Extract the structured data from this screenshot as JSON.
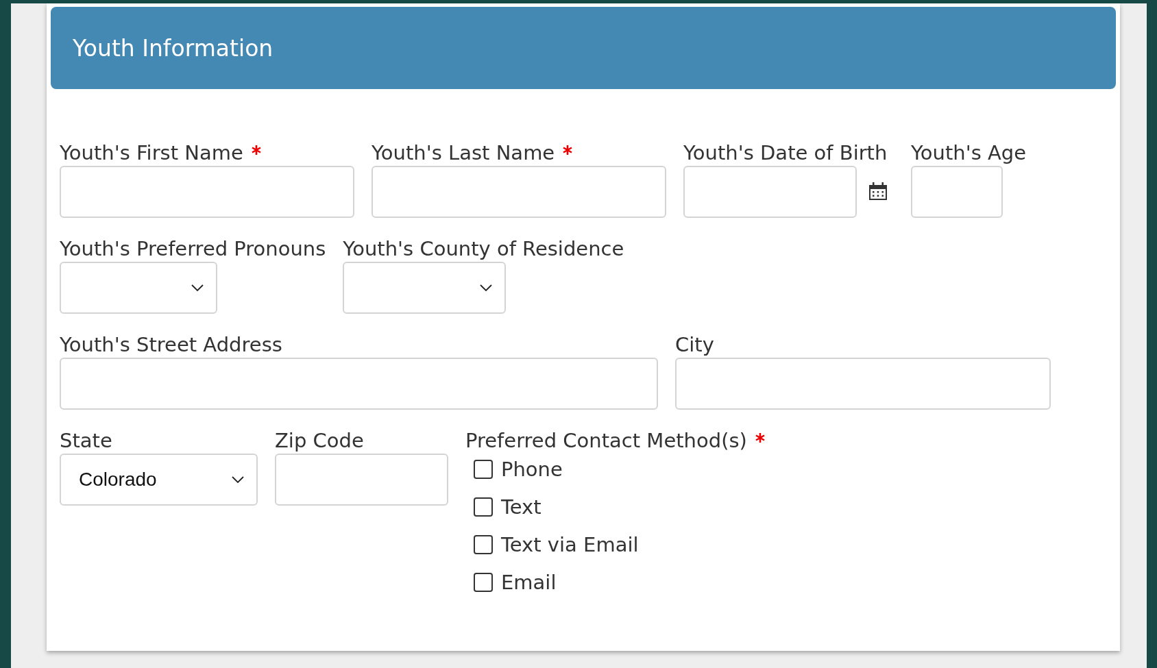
{
  "section": {
    "title": "Youth Information"
  },
  "rows": [
    {
      "fields": [
        {
          "kind": "text",
          "label": "Youth's First Name",
          "required": true
        },
        {
          "kind": "text",
          "label": "Youth's Last Name",
          "required": true
        },
        {
          "kind": "date",
          "label": "Youth's Date of Birth"
        },
        {
          "kind": "text",
          "label": "Youth's Age"
        }
      ]
    },
    {
      "fields": [
        {
          "kind": "select",
          "label": "Youth's Preferred Pronouns"
        },
        {
          "kind": "select",
          "label": "Youth's County of Residence"
        }
      ]
    },
    {
      "fields": [
        {
          "kind": "text",
          "label": "Youth's Street Address"
        },
        {
          "kind": "text",
          "label": "City"
        }
      ]
    },
    {
      "fields": [
        {
          "kind": "select",
          "label": "State",
          "value": "Colorado"
        },
        {
          "kind": "text",
          "label": "Zip Code"
        },
        {
          "kind": "checkboxes",
          "label": "Preferred Contact Method(s)",
          "required": true,
          "options": [
            {
              "label": "Phone",
              "checked": false
            },
            {
              "label": "Text",
              "checked": false
            },
            {
              "label": "Text via Email",
              "checked": false
            },
            {
              "label": "Email",
              "checked": false
            }
          ]
        }
      ]
    }
  ]
}
